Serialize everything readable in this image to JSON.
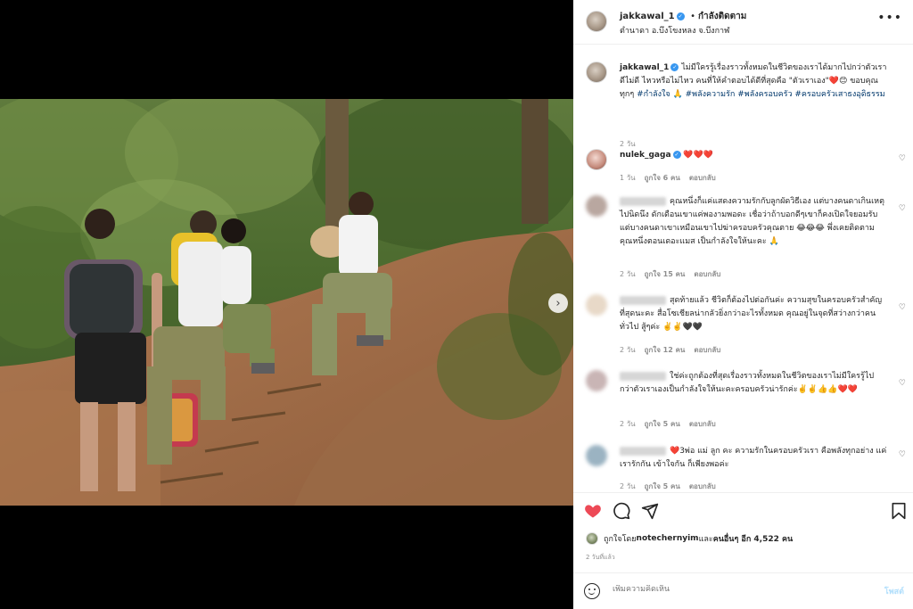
{
  "post": {
    "username": "jakkawal_1",
    "follow_separator": "•",
    "follow_label": "กำลังติดตาม",
    "location": "ตำนาดา อ.บึงโขงหลง จ.บึงกาฬ",
    "more_icon": "more-horizontal-icon"
  },
  "caption": {
    "username": "jakkawal_1",
    "text_1": "ไม่มีใครรู้เรื่องราวทั้งหมดในชีวิตของเราได้มากไปกว่าตัวเรา ดีไม่ดี ไหวหรือไม่ไหว คนที่ให้คำตอบได้ดีที่สุดคือ \"ตัวเราเอง\"",
    "emojis_1": "❤️😊",
    "text_2": " ขอบคุณทุกๆ ",
    "hashtag_1": "#กำลังใจ",
    "emoji_2": " 🙏 ",
    "hashtags_2": "#พลังความรัก #พลังครอบครัว #ครอบครัวเสาธงอุดิธรรม",
    "time": "2 วัน"
  },
  "comments": [
    {
      "username": "nulek_gaga",
      "text": "❤️❤️❤️",
      "time": "1 วัน",
      "likes": "ถูกใจ 6 คน",
      "reply": "ตอบกลับ"
    },
    {
      "username": "",
      "text": "คุณหนึ่งก็แค่แสดงความรักกับลูกผัดวิธีเอง แต่บางคนดาเกินเหตุไปนิดนึง ดักเดือนเขาแค่พองามพอดะ เชื่อว่าถ้าบอกดีๆเขาก็คงเปิดใจยอมรับ แต่บางคนดาเขาเหมือนเขาไปฆ่าครอบครัวคุณตาย 😂😂😂 พึ่งเคยติดตามคุณหนึ่งตอนเดอะแมส เป็นกำลังใจให้นะคะ 🙏",
      "time": "2 วัน",
      "likes": "ถูกใจ 15 คน",
      "reply": "ตอบกลับ"
    },
    {
      "username": "",
      "text": "สุดท้ายแล้ว ชีวิตก็ต้องไปต่อกันค่ะ ความสุขในครอบครัวสำคัญที่สุดนะคะ สื่อโซเชียลน่ากลัวยิ่งกว่าอะไรทั้งหมด คุณอยู่ในจุดที่สว่างกว่าคนทั่วไป สู้ๆค่ะ ✌️✌️🖤🖤",
      "time": "2 วัน",
      "likes": "ถูกใจ 12 คน",
      "reply": "ตอบกลับ"
    },
    {
      "username": "",
      "text": "ใช่ค่ะถูกต้องที่สุดเรื่องราวทั้งหมดในชีวิตของเราไม่มีใครรู้ไปกว่าตัวเราเองเป็นกำลังใจให้นะคะครอบครัวน่ารักค่ะ✌️✌️👍👍❤️❤️",
      "time": "2 วัน",
      "likes": "ถูกใจ 5 คน",
      "reply": "ตอบกลับ"
    },
    {
      "username": "",
      "text": "❤️3พ่อ แม่ ลูก คะ ความรักในครอบครัวเรา คือพลังทุกอย่าง แค่ เรารักกัน เข้าใจกัน ก็เพียงพอค่ะ",
      "time": "2 วัน",
      "likes": "ถูกใจ 5 คน",
      "reply": "ตอบกลับ"
    }
  ],
  "actions": {
    "like_icon": "heart-filled-icon",
    "comment_icon": "comment-icon",
    "share_icon": "share-icon",
    "save_icon": "bookmark-icon",
    "like_color": "#ed4956"
  },
  "likes": {
    "prefix": "ถูกใจโดย ",
    "user": "notechernyim",
    "middle": " และ ",
    "others": "คนอื่นๆ อีก 4,522 คน"
  },
  "posted": "2 วันที่แล้ว",
  "add_comment": {
    "placeholder": "เพิ่มความคิดเห็น",
    "post_label": "โพสต์"
  },
  "carousel": {
    "count": 9,
    "active_index": 6
  }
}
